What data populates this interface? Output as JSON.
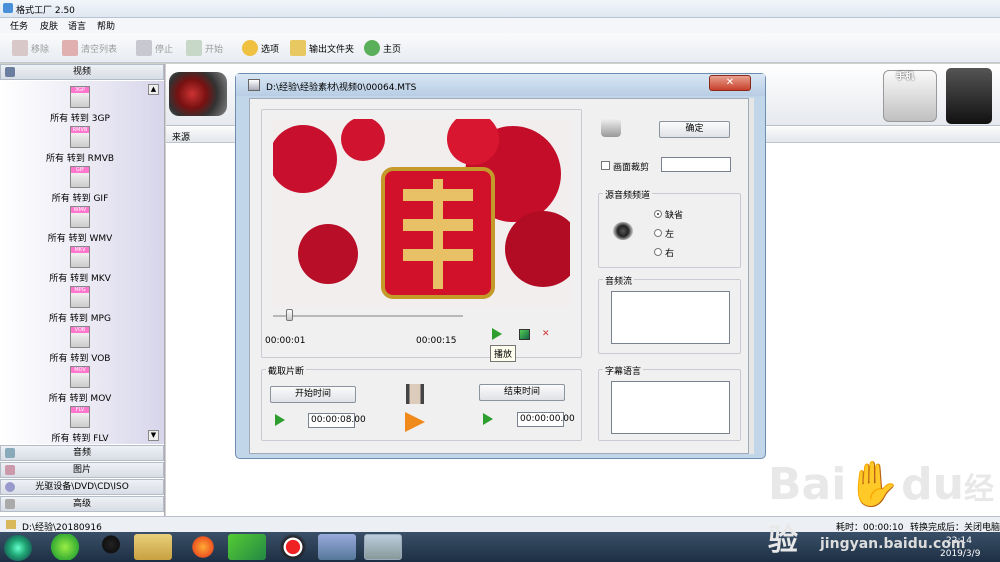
{
  "app": {
    "title": "格式工厂 2.50"
  },
  "menu": [
    "任务",
    "皮肤",
    "语言",
    "帮助"
  ],
  "toolbar": {
    "remove": "移除",
    "clear": "清空列表",
    "stop": "停止",
    "start": "开始",
    "options": "选项",
    "output_folder": "输出文件夹",
    "home": "主页"
  },
  "sidebar": {
    "video_header": "视频",
    "video_items": [
      {
        "badge": "3GP",
        "label": "所有 转到 3GP"
      },
      {
        "badge": "RMVB",
        "label": "所有 转到 RMVB"
      },
      {
        "badge": "GIF",
        "label": "所有 转到 GIF"
      },
      {
        "badge": "WMV",
        "label": "所有 转到 WMV"
      },
      {
        "badge": "MKV",
        "label": "所有 转到 MKV"
      },
      {
        "badge": "MPG",
        "label": "所有 转到 MPG"
      },
      {
        "badge": "VOB",
        "label": "所有 转到 VOB"
      },
      {
        "badge": "MOV",
        "label": "所有 转到 MOV"
      },
      {
        "badge": "FLV",
        "label": "所有 转到 FLV"
      }
    ],
    "audio_header": "音频",
    "image_header": "图片",
    "disc_header": "光驱设备\\DVD\\CD\\ISO",
    "advanced_header": "高级"
  },
  "main": {
    "source_col": "来源",
    "phone_label": "手机"
  },
  "dialog": {
    "title": "D:\\经验\\经验素材\\视频0\\00064.MTS",
    "confirm": "确定",
    "crop_label": "画面裁剪",
    "audio_channel_group": "源音频频道",
    "channel_options": [
      "缺省",
      "左",
      "右"
    ],
    "audio_stream_group": "音频流",
    "subtitle_group": "字幕语言",
    "time_current": "00:00:01",
    "time_total": "00:00:15",
    "play_tooltip": "播放",
    "clip_group": "截取片断",
    "start_time_btn": "开始时间",
    "end_time_btn": "结束时间",
    "start_time_val": "00:00:08.00",
    "end_time_val": "00:00:00.00",
    "seek_fraction": 0.07
  },
  "status": {
    "path": "D:\\经验\\20180916",
    "elapsed": "耗时：00:00:10",
    "after_complete": "转换完成后：关闭电脑"
  },
  "taskbar": {
    "time": "22:14",
    "date": "2019/3/9"
  },
  "watermark": {
    "brand": "Bai",
    "brand2": "du",
    "cn": "经验",
    "url": "jingyan.baidu.com"
  }
}
